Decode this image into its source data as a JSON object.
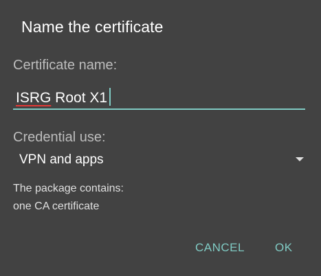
{
  "dialog": {
    "title": "Name the certificate",
    "certificate_name_label": "Certificate name:",
    "certificate_name_value_misspelled": "ISRG",
    "certificate_name_value_rest": " Root X1",
    "credential_use_label": "Credential use:",
    "credential_use_value": "VPN and apps",
    "dropdown_icon": "arrow-drop-down-icon",
    "info_line_1": "The package contains:",
    "info_line_2": "one CA certificate",
    "cancel_label": "CANCEL",
    "ok_label": "OK"
  },
  "colors": {
    "background": "#424242",
    "accent": "#80cbc4",
    "spellcheck_underline": "#e53935"
  }
}
